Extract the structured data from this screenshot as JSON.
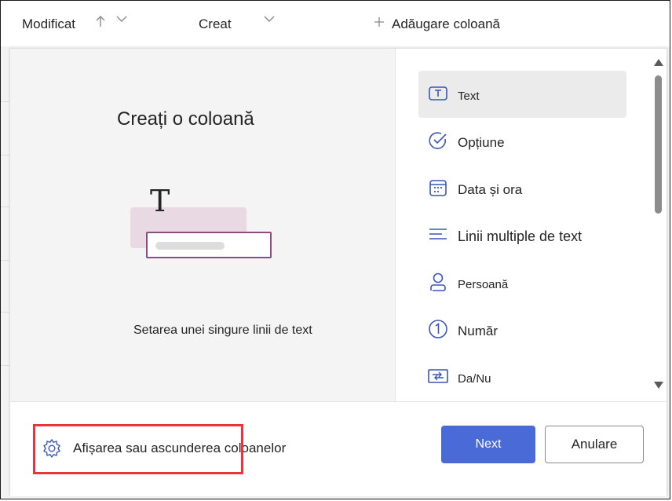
{
  "header": {
    "columns": [
      {
        "label": "Modificat"
      },
      {
        "label": "Creat"
      }
    ],
    "add_column_label": "Adăugare coloană"
  },
  "preview": {
    "title": "Creați o coloană",
    "description": "Setarea unei singure linii de text"
  },
  "types": [
    {
      "label": "Text",
      "icon": "text-box-icon",
      "selected": true
    },
    {
      "label": "Opțiune",
      "icon": "check-circle-icon"
    },
    {
      "label": "Data și ora",
      "icon": "calendar-icon"
    },
    {
      "label": "Linii multiple de text",
      "icon": "multiline-text-icon"
    },
    {
      "label": "Persoană",
      "icon": "person-icon"
    },
    {
      "label": "Număr",
      "icon": "number-one-icon"
    },
    {
      "label": "Da/Nu",
      "icon": "yes-no-icon"
    }
  ],
  "footer": {
    "show_hide_label": "Afișarea sau ascunderea coloanelor",
    "next_label": "Next",
    "cancel_label": "Anulare"
  },
  "colors": {
    "accent": "#4a6ad8",
    "highlight": "#e8353b",
    "illustration_border": "#8c4f7d",
    "selected_bg": "#ebebeb"
  }
}
